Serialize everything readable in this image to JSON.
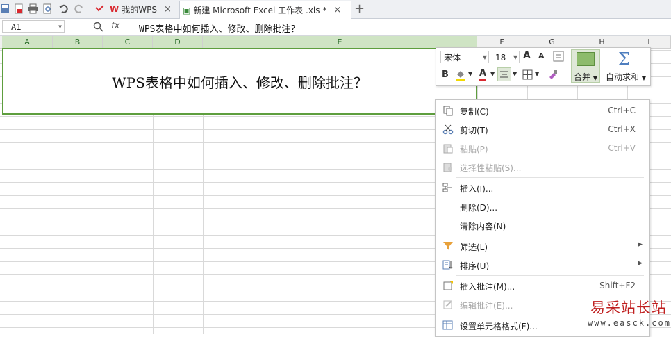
{
  "tabs": [
    {
      "label": "我的WPS",
      "close": "×"
    },
    {
      "label": "新建 Microsoft Excel 工作表 .xls *",
      "close": "×"
    }
  ],
  "new_tab": "+",
  "name_box": "A1",
  "fx_label": "fx",
  "formula": "WPS表格中如何插入、修改、删除批注？",
  "columns": [
    "A",
    "B",
    "C",
    "D",
    "E",
    "F",
    "G",
    "H",
    "I"
  ],
  "cell_text": "WPS表格中如何插入、修改、删除批注？",
  "mini_toolbar": {
    "font": "宋体",
    "size": "18",
    "grow": "A",
    "shrink": "A",
    "bold": "B",
    "font_color": "A",
    "merge": "合并",
    "autosum": "自动求和"
  },
  "menu": [
    {
      "label": "复制(C)",
      "shortcut": "Ctrl+C",
      "icon": "copy-icon"
    },
    {
      "label": "剪切(T)",
      "shortcut": "Ctrl+X",
      "icon": "scissors-icon"
    },
    {
      "label": "粘贴(P)",
      "shortcut": "Ctrl+V",
      "icon": "paste-icon",
      "disabled": true
    },
    {
      "label": "选择性粘贴(S)...",
      "shortcut": "",
      "icon": "paste-special-icon",
      "disabled": true
    },
    {
      "label": "插入(I)...",
      "shortcut": "",
      "icon": "insert-icon"
    },
    {
      "label": "删除(D)...",
      "shortcut": ""
    },
    {
      "label": "清除内容(N)",
      "shortcut": ""
    },
    {
      "label": "筛选(L)",
      "shortcut": "",
      "icon": "filter-icon",
      "submenu": true
    },
    {
      "label": "排序(U)",
      "shortcut": "",
      "icon": "sort-icon",
      "submenu": true
    },
    {
      "label": "插入批注(M)...",
      "shortcut": "Shift+F2",
      "icon": "comment-icon"
    },
    {
      "label": "编辑批注(E)...",
      "shortcut": "",
      "icon": "edit-comment-icon",
      "disabled": true
    },
    {
      "label": "设置单元格格式(F)...",
      "shortcut": "",
      "icon": "format-cells-icon"
    }
  ],
  "watermark": {
    "cn": "易采站长站",
    "url": "www.easck.com"
  },
  "colors": {
    "accent": "#5e9e3e",
    "wps_red": "#d9282f",
    "watermark": "#c02020"
  }
}
